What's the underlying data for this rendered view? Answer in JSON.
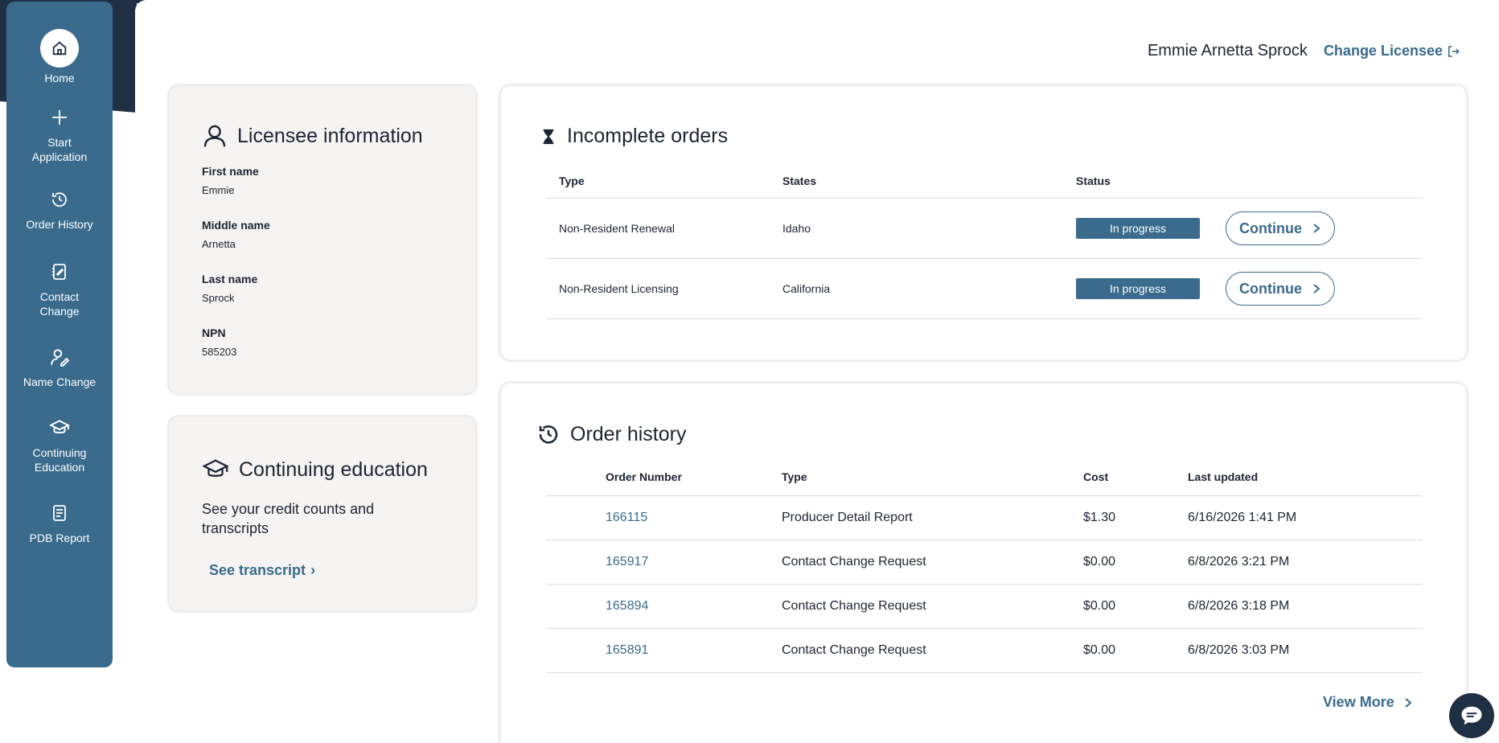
{
  "sidebar": {
    "items": [
      {
        "label": "Home",
        "icon": "home-icon"
      },
      {
        "label": "Start Application",
        "icon": "plus-icon"
      },
      {
        "label": "Order History",
        "icon": "history-icon"
      },
      {
        "label": "Contact Change",
        "icon": "contact-edit-icon"
      },
      {
        "label": "Name Change",
        "icon": "user-edit-icon"
      },
      {
        "label": "Continuing Education",
        "icon": "graduation-cap-icon"
      },
      {
        "label": "PDB Report",
        "icon": "report-icon"
      }
    ]
  },
  "header": {
    "user_name": "Emmie Arnetta Sprock",
    "change_link": "Change Licensee"
  },
  "licensee": {
    "title": "Licensee information",
    "fields": [
      {
        "label": "First name",
        "value": "Emmie"
      },
      {
        "label": "Middle name",
        "value": "Arnetta"
      },
      {
        "label": "Last name",
        "value": "Sprock"
      },
      {
        "label": "NPN",
        "value": "585203"
      }
    ]
  },
  "education": {
    "title": "Continuing education",
    "description": "See your credit counts and transcripts",
    "link": "See transcript"
  },
  "incomplete": {
    "title": "Incomplete orders",
    "headers": [
      "Type",
      "States",
      "Status"
    ],
    "rows": [
      {
        "type": "Non-Resident Renewal",
        "state": "Idaho",
        "status": "In progress",
        "action": "Continue"
      },
      {
        "type": "Non-Resident Licensing",
        "state": "California",
        "status": "In progress",
        "action": "Continue"
      }
    ]
  },
  "history": {
    "title": "Order history",
    "headers": [
      "Order Number",
      "Type",
      "Cost",
      "Last updated"
    ],
    "rows": [
      {
        "number": "166115",
        "type": "Producer Detail Report",
        "cost": "$1.30",
        "updated": "6/16/2026 1:41 PM"
      },
      {
        "number": "165917",
        "type": "Contact Change Request",
        "cost": "$0.00",
        "updated": "6/8/2026 3:21 PM"
      },
      {
        "number": "165894",
        "type": "Contact Change Request",
        "cost": "$0.00",
        "updated": "6/8/2026 3:18 PM"
      },
      {
        "number": "165891",
        "type": "Contact Change Request",
        "cost": "$0.00",
        "updated": "6/8/2026 3:03 PM"
      }
    ],
    "view_more": "View More"
  },
  "colors": {
    "accent": "#3a6b8c",
    "dark": "#1f2f44"
  }
}
